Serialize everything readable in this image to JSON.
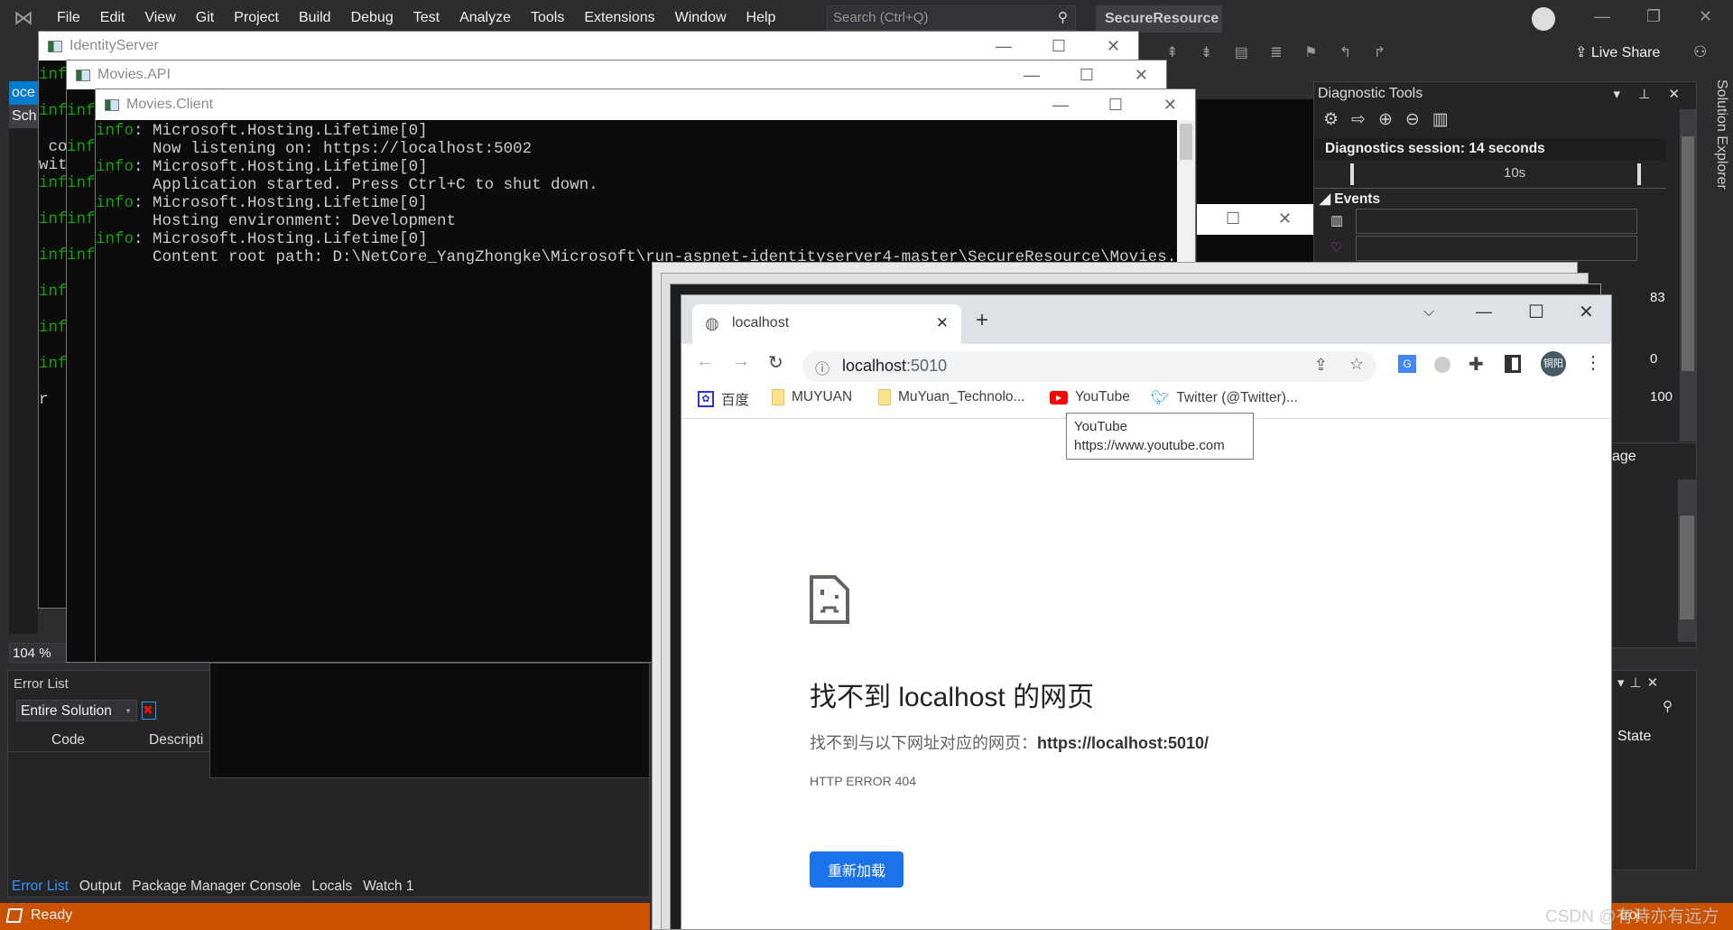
{
  "vs": {
    "menu": [
      "File",
      "Edit",
      "View",
      "Git",
      "Project",
      "Build",
      "Debug",
      "Test",
      "Analyze",
      "Tools",
      "Extensions",
      "Window",
      "Help"
    ],
    "search_placeholder": "Search (Ctrl+Q)",
    "solution": "SecureResource",
    "live_share": "Live Share",
    "solution_explorer": "Solution Explorer",
    "left_tab_1": "oce",
    "left_tab_2": "Sch",
    "zoom": "104 %",
    "error_list": {
      "title": "Error List",
      "scope": "Entire Solution",
      "columns": [
        "Code",
        "Descripti"
      ]
    },
    "bottom_tabs": [
      "Error List",
      "Output",
      "Package Manager Console",
      "Locals",
      "Watch 1"
    ],
    "status": "Ready",
    "status_right": "trol",
    "diag": {
      "title": "Diagnostic Tools",
      "session": "Diagnostics session: 14 seconds",
      "tick": "10s",
      "events": "Events",
      "v83": "83",
      "v0": "0",
      "v100": "100",
      "usage": "age"
    },
    "right_state": "State"
  },
  "consoles": {
    "identity": {
      "title": "IdentityServer",
      "lines": [
        "inf",
        "",
        "inf",
        "",
        "",
        "inf",
        "",
        "inf",
        "",
        "inf",
        "",
        "inf",
        "",
        "inf"
      ]
    },
    "api": {
      "title": "Movies.API"
    },
    "client": {
      "title": "Movies.Client",
      "lines": [
        {
          "level": "info",
          "text": ": Microsoft.Hosting.Lifetime[0]"
        },
        {
          "level": "",
          "text": "      Now listening on: https://localhost:5002"
        },
        {
          "level": "info",
          "text": ": Microsoft.Hosting.Lifetime[0]"
        },
        {
          "level": "",
          "text": "      Application started. Press Ctrl+C to shut down."
        },
        {
          "level": "info",
          "text": ": Microsoft.Hosting.Lifetime[0]"
        },
        {
          "level": "",
          "text": "      Hosting environment: Development"
        },
        {
          "level": "info",
          "text": ": Microsoft.Hosting.Lifetime[0]"
        },
        {
          "level": "",
          "text": "      Content root path: D:\\NetCore_YangZhongke\\Microsoft\\run-aspnet-identityserver4-master\\SecureResource\\Movies.Client"
        }
      ]
    },
    "identity_text": [
      "co",
      "wit",
      "r"
    ]
  },
  "browser": {
    "tab_title": "localhost",
    "url_host": "localhost",
    "url_port": ":5010",
    "profile": "铜阳",
    "bookmarks": [
      "百度",
      "MUYUAN",
      "MuYuan_Technolo...",
      "YouTube",
      "Twitter (@Twitter)..."
    ],
    "tooltip": {
      "title": "YouTube",
      "url": "https://www.youtube.com"
    },
    "error": {
      "heading": "找不到 localhost 的网页",
      "desc": "找不到与以下网址对应的网页：",
      "desc_url": "https://localhost:5010/",
      "code": "HTTP ERROR 404",
      "reload": "重新加载"
    }
  },
  "watermark": "CSDN @有诗亦有远方",
  "colors": {
    "status_bar": "#ca5100",
    "accent": "#1a73e8",
    "console_green": "#13a10e"
  }
}
